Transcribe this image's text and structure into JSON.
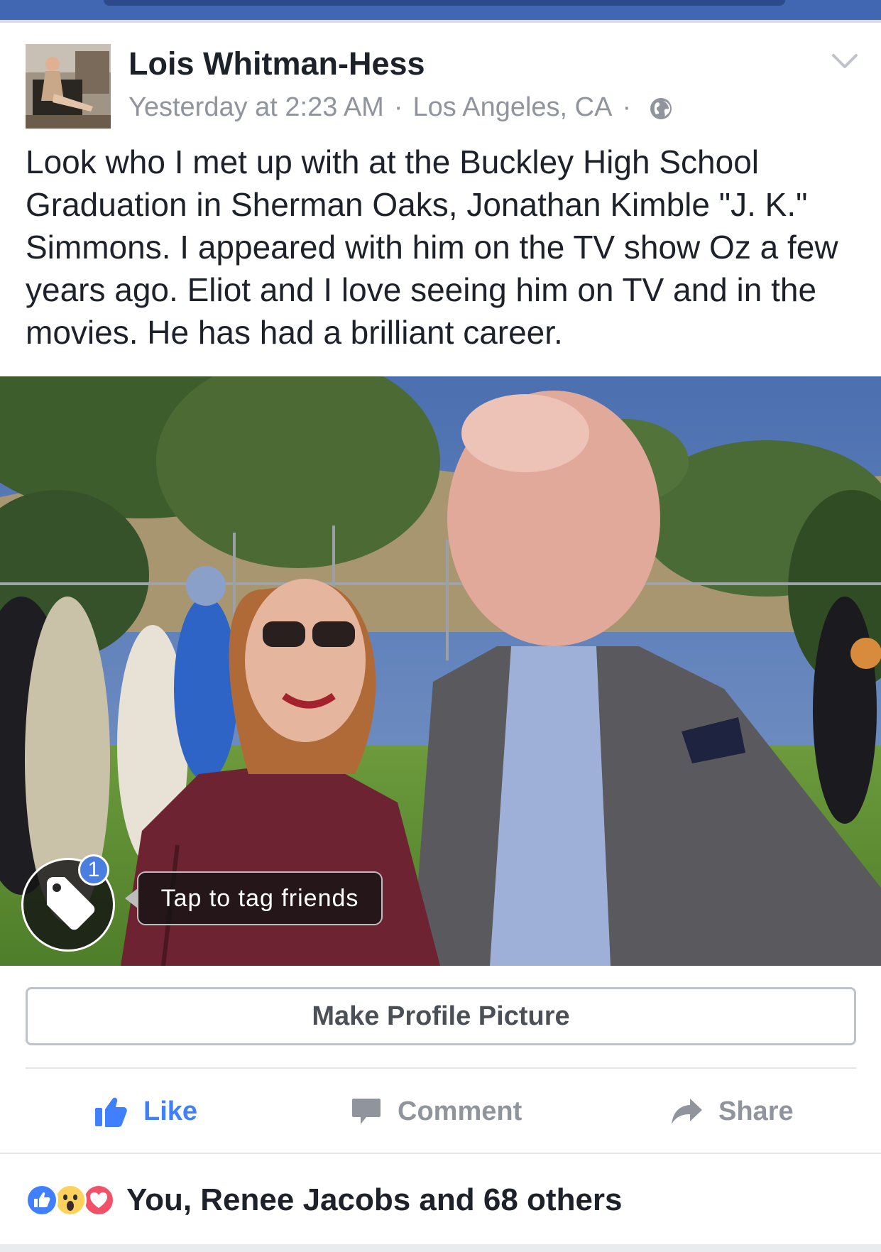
{
  "post": {
    "author": "Lois Whitman-Hess",
    "timestamp": "Yesterday at 2:23 AM",
    "location": "Los Angeles, CA",
    "separator": "·",
    "privacy_icon": "globe-icon",
    "options_icon": "chevron-down-icon",
    "text": "Look who I met up with at the Buckley High School Graduation in Sherman Oaks, Jonathan Kimble \"J. K.\" Simmons. I appeared with him on the TV show Oz a few years ago. Eliot and I love seeing him on TV and in the movies. He has had a brilliant career."
  },
  "photo": {
    "tag_count": "1",
    "tag_prompt": "Tap to tag friends",
    "tag_icon": "tag-icon"
  },
  "make_profile_picture_label": "Make Profile Picture",
  "actions": {
    "like": "Like",
    "comment": "Comment",
    "share": "Share"
  },
  "reactions": {
    "icons": [
      "like-reaction-icon",
      "wow-reaction-icon",
      "love-reaction-icon"
    ],
    "summary": "You, Renee Jacobs and 68 others"
  },
  "colors": {
    "brand_blue": "#4267b2",
    "like_blue": "#4080ff",
    "meta_gray": "#90949c",
    "love_red": "#f25268",
    "wow_yellow": "#fcd15c"
  }
}
